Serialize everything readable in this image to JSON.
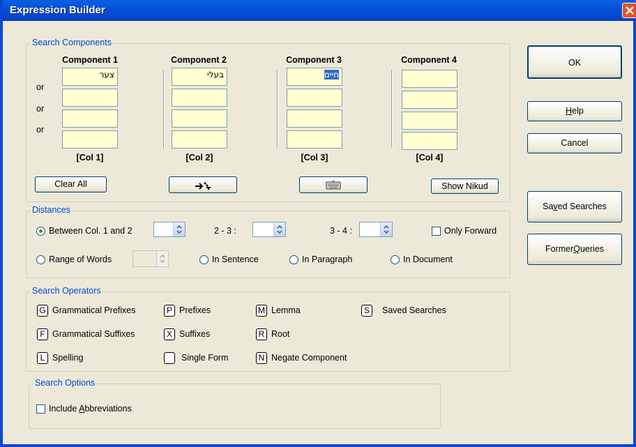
{
  "window": {
    "title": "Expression Builder"
  },
  "search_components": {
    "label": "Search Components",
    "or_label": "or",
    "components": [
      {
        "title": "Component 1",
        "values": [
          "צער",
          "",
          "",
          ""
        ],
        "col": "[Col 1]"
      },
      {
        "title": "Component 2",
        "values": [
          "בעלי",
          "",
          "",
          ""
        ],
        "col": "[Col 2]"
      },
      {
        "title": "Component 3",
        "values": [
          "חיים",
          "",
          "",
          ""
        ],
        "col": "[Col 3]"
      },
      {
        "title": "Component 4",
        "values": [
          "",
          "",
          "",
          ""
        ],
        "col": "[Col 4]"
      }
    ],
    "clear_all": "Clear All",
    "show_nikud": "Show Nikud",
    "dir_icon": "text-direction-icon",
    "keyboard_icon": "keyboard-icon"
  },
  "distances": {
    "label": "Distances",
    "between": "Between Col. 1 and 2",
    "d23": "2 - 3 :",
    "d34": "3 - 4 :",
    "only_forward": "Only Forward",
    "range_of_words": "Range of Words",
    "in_sentence": "In Sentence",
    "in_paragraph": "In Paragraph",
    "in_document": "In Document"
  },
  "operators": {
    "label": "Search Operators",
    "items": [
      {
        "key": "G",
        "label": "Grammatical Prefixes"
      },
      {
        "key": "F",
        "label": "Grammatical Suffixes"
      },
      {
        "key": "L",
        "label": "Spelling"
      },
      {
        "key": "P",
        "label": "Prefixes"
      },
      {
        "key": "X",
        "label": "Suffixes"
      },
      {
        "key": "",
        "label": "Single Form"
      },
      {
        "key": "M",
        "label": "Lemma"
      },
      {
        "key": "R",
        "label": "Root"
      },
      {
        "key": "N",
        "label": "Negate Component"
      },
      {
        "key": "S",
        "label": "Saved Searches"
      }
    ]
  },
  "options": {
    "label": "Search Options",
    "include_abbrev_pre": "Include ",
    "include_abbrev_u": "A",
    "include_abbrev_post": "bbreviations"
  },
  "buttons": {
    "ok": "OK",
    "help_u": "H",
    "help_rest": "elp",
    "cancel": "Cancel",
    "saved_pre": "Sa",
    "saved_u": "v",
    "saved_post": "ed Searches",
    "former_pre": "Former ",
    "former_u": "Q",
    "former_post": "ueries"
  }
}
